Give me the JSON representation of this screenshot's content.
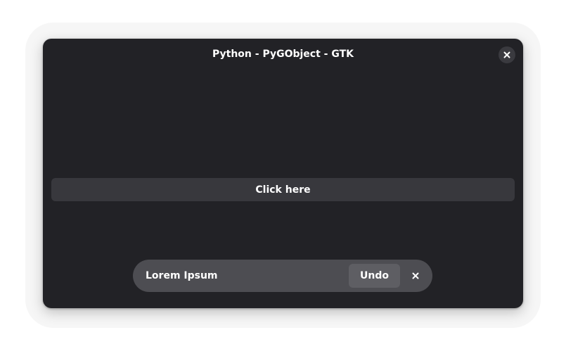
{
  "window": {
    "title": "Python - PyGObject - GTK",
    "close_icon": "close-icon"
  },
  "main": {
    "button_label": "Click here"
  },
  "toast": {
    "message": "Lorem Ipsum",
    "undo_label": "Undo",
    "dismiss_icon": "close-icon"
  },
  "colors": {
    "window_bg": "#222226",
    "button_bg": "#38383d",
    "toast_bg": "#4d4d52",
    "toast_button_bg": "#5e5e63",
    "text": "#ffffff"
  }
}
